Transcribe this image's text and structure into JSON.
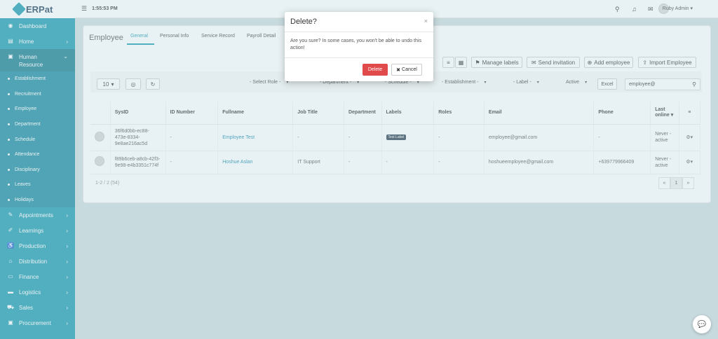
{
  "app": {
    "name": "ERPat"
  },
  "colors": {
    "accent": "#1a9ab0",
    "danger": "#e04a4a"
  },
  "topbar": {
    "time": "1:55:53 PM",
    "user_name": "Ruby Admin"
  },
  "sidebar": {
    "items": [
      {
        "label": "Dashboard",
        "icon": "dashboard-icon"
      },
      {
        "label": "Home",
        "icon": "home-icon"
      },
      {
        "label": "Human Resource",
        "icon": "briefcase-icon"
      }
    ],
    "hr_sub": [
      "Establishment",
      "Recruitment",
      "Employee",
      "Department",
      "Schedule",
      "Attendance",
      "Disciplinary",
      "Leaves",
      "Holidays"
    ],
    "lower": [
      {
        "label": "Appointments",
        "icon": "edit-icon"
      },
      {
        "label": "Learnings",
        "icon": "wrench-icon"
      },
      {
        "label": "Production",
        "icon": "wheelchair-icon"
      },
      {
        "label": "Distribution",
        "icon": "bank-icon"
      },
      {
        "label": "Finance",
        "icon": "money-icon"
      },
      {
        "label": "Logistics",
        "icon": "truck-icon"
      },
      {
        "label": "Sales",
        "icon": "cart-icon"
      },
      {
        "label": "Procurement",
        "icon": "briefcase-icon"
      }
    ]
  },
  "page": {
    "title": "Employee",
    "tabs": [
      "General",
      "Personal Info",
      "Service Record",
      "Payroll Detail"
    ]
  },
  "toolbar": {
    "manage_labels": "Manage labels",
    "send_invitation": "Send invitation",
    "add_employee": "Add employee",
    "import_employee": "Import Employee"
  },
  "filters": {
    "page_size": "10",
    "role": "- Select Role -",
    "department": "- Department -",
    "schedule": "- Schedule -",
    "establishment": "- Establishment -",
    "label": "- Label -",
    "status": "Active",
    "excel": "Excel",
    "search_value": "employee@"
  },
  "table": {
    "headers": [
      "SysID",
      "ID Number",
      "Fullname",
      "Job Title",
      "Department",
      "Labels",
      "Roles",
      "Email",
      "Phone",
      "Last online"
    ],
    "rows": [
      {
        "sysid": "36f6d0bb-ec88-473e-8334-9e8ae216ac5d",
        "id_number": "-",
        "fullname": "Employee Test",
        "job_title": "-",
        "department": "-",
        "label": "Test Label",
        "roles": "-",
        "email": "employee@gmail.com",
        "phone": "-",
        "last_online": "Never - active"
      },
      {
        "sysid": "f89b6ceb-a8cb-42f3-9e98-e4b3351c774f",
        "id_number": "-",
        "fullname": "Hoshue Aslan",
        "job_title": "IT Support",
        "department": "-",
        "label": "-",
        "roles": "-",
        "email": "hoshueemployee@gmail.com",
        "phone": "+639779966409",
        "last_online": "Never - active"
      }
    ]
  },
  "pagination": {
    "info": "1-2 / 2 (54)",
    "prev": "«",
    "current": "1",
    "next": "»"
  },
  "modal": {
    "title": "Delete?",
    "close": "×",
    "message": "Are you sure? In some cases, you won't be able to undo this action!",
    "delete_label": "Delete",
    "cancel_label": "Cancel"
  }
}
